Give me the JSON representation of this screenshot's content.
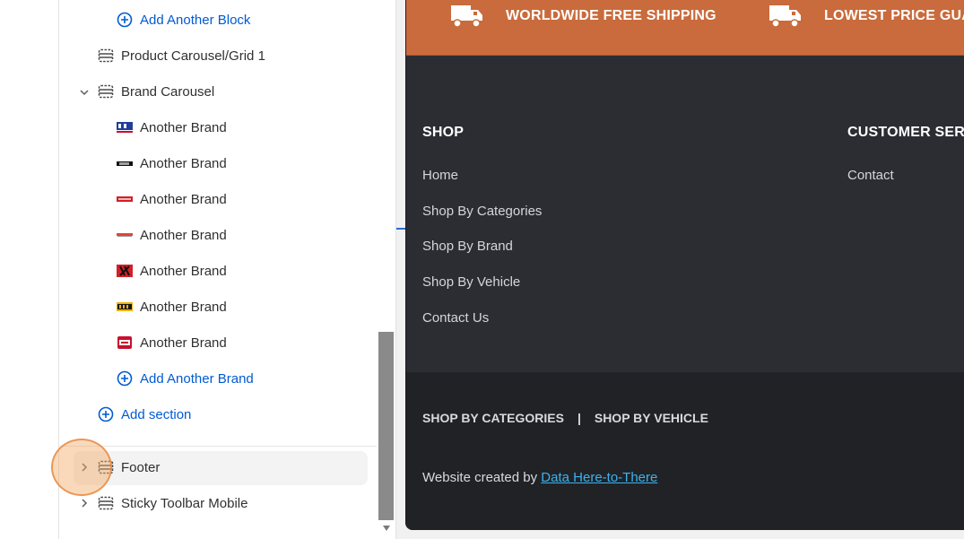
{
  "editor": {
    "tree": {
      "add_block_label": "Add Another Block",
      "product_section_label": "Product Carousel/Grid 1",
      "brand_section": {
        "label": "Brand Carousel",
        "brands": [
          {
            "label": "Another Brand",
            "logo": "brand-logo-blue"
          },
          {
            "label": "Another Brand",
            "logo": "brand-logo-black"
          },
          {
            "label": "Another Brand",
            "logo": "brand-logo-red"
          },
          {
            "label": "Another Brand",
            "logo": "brand-logo-red-thin"
          },
          {
            "label": "Another Brand",
            "logo": "brand-logo-red-black"
          },
          {
            "label": "Another Brand",
            "logo": "brand-logo-yellow"
          },
          {
            "label": "Another Brand",
            "logo": "brand-logo-red-badge"
          }
        ],
        "add_brand_label": "Add Another Brand"
      },
      "add_section_label": "Add section",
      "footer_label": "Footer",
      "sticky_toolbar_label": "Sticky Toolbar Mobile"
    }
  },
  "preview": {
    "promo_bar": {
      "items": [
        "WORLDWIDE FREE SHIPPING",
        "LOWEST PRICE GUAR"
      ],
      "icon": "truck-icon"
    },
    "footer": {
      "columns": [
        {
          "heading": "SHOP",
          "links": [
            "Home",
            "Shop By Categories",
            "Shop By Brand",
            "Shop By Vehicle",
            "Contact Us"
          ]
        },
        {
          "heading": "CUSTOMER SERV",
          "links": [
            "Contact"
          ]
        }
      ],
      "bottom_links": [
        "SHOP BY CATEGORIES",
        "SHOP BY VEHICLE"
      ],
      "separator": "|",
      "credit_prefix": "Website created by",
      "credit_link": "Data Here-to-There"
    }
  },
  "colors": {
    "accent_link": "#005bd3",
    "promo_bar": "#c96b3c",
    "footer_bg": "#2b2d33",
    "footer_bottom_bg": "#212226",
    "credit_link": "#3ab3f0"
  }
}
